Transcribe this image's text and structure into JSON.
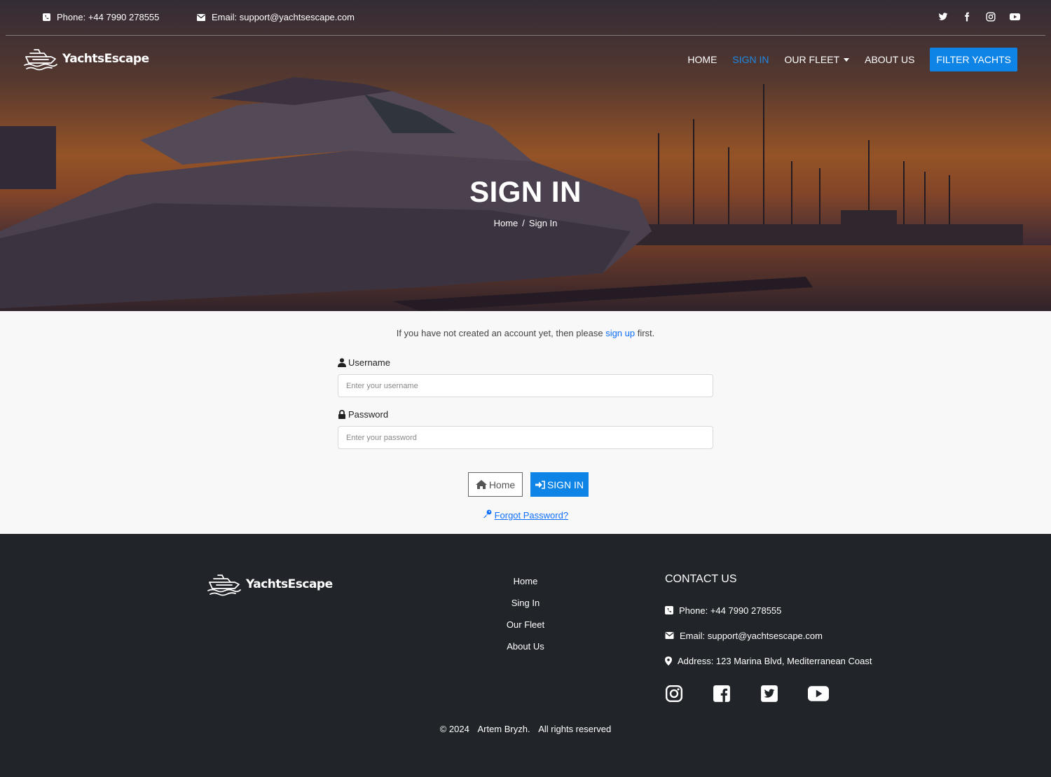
{
  "topbar": {
    "phone": "Phone: +44 7990 278555",
    "email": "Email: support@yachtsescape.com",
    "social": [
      "twitter-icon",
      "facebook-icon",
      "instagram-icon",
      "youtube-icon"
    ]
  },
  "brand": {
    "name": "YachtsEscape"
  },
  "nav": {
    "home": "HOME",
    "sign_in": "SIGN IN",
    "our_fleet": "OUR FLEET",
    "about_us": "ABOUT US",
    "filter_yachts": "FILTER YACHTS"
  },
  "hero": {
    "title": "SIGN IN",
    "breadcrumb_home": "Home",
    "breadcrumb_divider": "/",
    "breadcrumb_current": "Sign In"
  },
  "form": {
    "intro_before": "If you have not created an account yet, then please ",
    "intro_link": "sign up",
    "intro_after": " first.",
    "username_label": "Username",
    "username_placeholder": "Enter your username",
    "password_label": "Password",
    "password_placeholder": "Enter your password",
    "home_button": "Home",
    "sign_in_button": "SIGN IN",
    "forgot_password": "Forgot Password?"
  },
  "footer": {
    "links": [
      "Home",
      "Sing In",
      "Our Fleet",
      "About Us"
    ],
    "contact_title": "CONTACT US",
    "phone": "Phone: +44 7990 278555",
    "email": "Email: support@yachtsescape.com",
    "address": "Address: 123 Marina Blvd, Mediterranean Coast",
    "social": [
      "instagram-icon",
      "facebook-icon",
      "twitter-icon",
      "youtube-icon"
    ],
    "copyright_year": "© 2024",
    "copyright_author": "Artem Bryzh.",
    "copyright_rights": "All rights reserved"
  },
  "colors": {
    "accent": "#0d84e6",
    "link": "#0d6efd",
    "footer_bg": "#212529",
    "page_bg": "#f8f8f8"
  }
}
